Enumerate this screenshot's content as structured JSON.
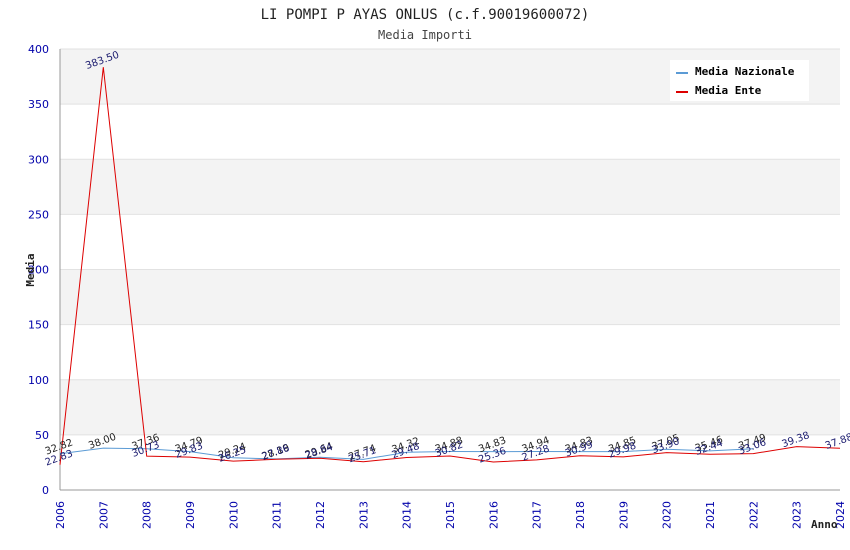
{
  "chart_data": {
    "type": "line",
    "title": "LI POMPI P AYAS ONLUS (c.f.90019600072)",
    "subtitle": "Media Importi",
    "xlabel": "Anno",
    "ylabel": "Media",
    "ylim": [
      0,
      400
    ],
    "yticks": [
      "0",
      "50",
      "100",
      "150",
      "200",
      "250",
      "300",
      "350",
      "400"
    ],
    "grid": true,
    "legend_position": "top-right",
    "x": [
      "2006",
      "2007",
      "2008",
      "2009",
      "2010",
      "2011",
      "2012",
      "2013",
      "2014",
      "2015",
      "2016",
      "2017",
      "2018",
      "2019",
      "2020",
      "2021",
      "2022",
      "2023",
      "2024"
    ],
    "series": [
      {
        "name": "Media Nazionale",
        "color": "#5b9bd5",
        "values": [
          32.82,
          38.0,
          37.36,
          34.79,
          29.24,
          28.19,
          29.64,
          27.74,
          34.32,
          34.88,
          34.83,
          34.94,
          34.83,
          34.85,
          37.05,
          35.46,
          37.49,
          null,
          null
        ],
        "labels": [
          "32.82",
          "38.00",
          "37.36",
          "34.79",
          "29.24",
          "28.19",
          "29.64",
          "27.74",
          "34.32",
          "34.88",
          "34.83",
          "34.94",
          "34.83",
          "34.85",
          "37.05",
          "35.46",
          "37.49",
          "",
          ""
        ]
      },
      {
        "name": "Media Ente",
        "color": "#dd0000",
        "values": [
          22.83,
          383.5,
          30.73,
          29.83,
          26.25,
          27.86,
          28.84,
          25.71,
          29.48,
          30.82,
          25.36,
          27.28,
          30.99,
          29.98,
          33.9,
          32.44,
          33.06,
          39.38,
          37.88
        ],
        "labels": [
          "22.83",
          "383.50",
          "30.73",
          "29.83",
          "26.25",
          "27.86",
          "28.84",
          "25.71",
          "29.48",
          "30.82",
          "25.36",
          "27.28",
          "30.99",
          "29.98",
          "33.90",
          "32.44",
          "33.06",
          "39.38",
          "37.88"
        ]
      }
    ]
  }
}
